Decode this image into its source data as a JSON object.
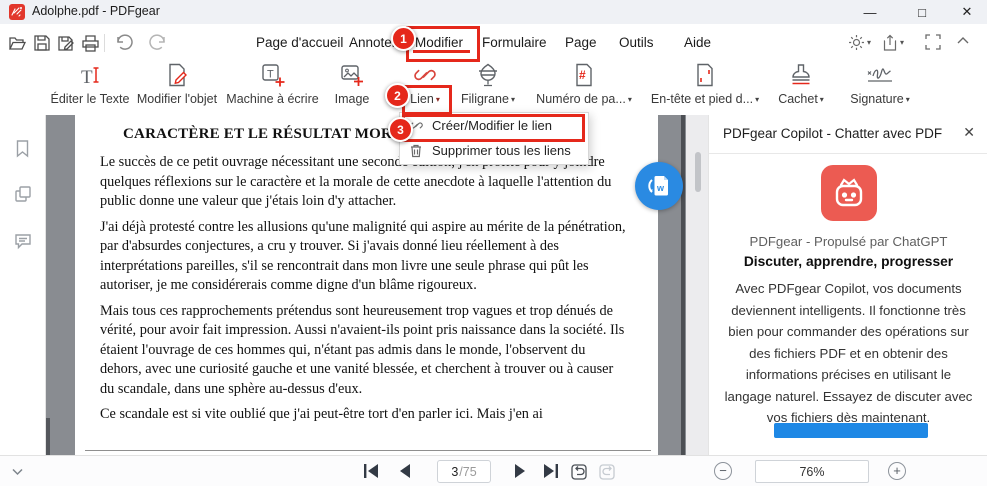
{
  "colors": {
    "annotation_red": "#e5281b",
    "pdfgear_red": "#e2372c",
    "copilot_red": "#ec5b52",
    "accent_blue": "#1e88e5",
    "doc_background": "#898c91"
  },
  "window": {
    "title": "Adolphe.pdf - PDFgear",
    "minimize": "—",
    "maximize": "□",
    "close": "✕"
  },
  "icons": {
    "caret_down": "▾",
    "close": "✕",
    "minus": "−",
    "plus": "+",
    "hash": "#",
    "letter_t": "T",
    "letter_w": "w"
  },
  "menu": {
    "items": [
      {
        "label": "Page d'accueil"
      },
      {
        "label": "Annoter"
      },
      {
        "label": "Modifier",
        "active": true
      },
      {
        "label": "Formulaire"
      },
      {
        "label": "Page"
      },
      {
        "label": "Outils"
      },
      {
        "label": "Aide"
      }
    ]
  },
  "toolbar": {
    "tools": [
      {
        "label": "Éditer le Texte"
      },
      {
        "label": "Modifier l'objet"
      },
      {
        "label": "Machine à écrire"
      },
      {
        "label": "Image"
      },
      {
        "label": "Lien",
        "caret": true,
        "highlighted": true
      },
      {
        "label": "Filigrane",
        "caret": true
      },
      {
        "label": "Numéro de pa...",
        "caret": true
      },
      {
        "label": "En-tête et pied d...",
        "caret": true
      },
      {
        "label": "Cachet",
        "caret": true
      },
      {
        "label": "Signature",
        "caret": true
      }
    ]
  },
  "steps": {
    "one": "1",
    "two": "2",
    "three": "3"
  },
  "link_menu": {
    "items": [
      {
        "label": "Créer/Modifier le lien",
        "highlighted": true
      },
      {
        "label": "Supprimer tous les liens"
      }
    ]
  },
  "document": {
    "heading": "CARACTÈRE ET LE RÉSULTAT MORAL",
    "paragraphs": [
      "Le succès de ce petit ouvrage nécessitant une seconde édition, j'en profite pour y joindre quelques réflexions sur le caractère et la morale de cette anecdote à laquelle l'attention du public donne une valeur que j'étais loin d'y attacher.",
      "J'ai déjà protesté contre les allusions qu'une malignité qui aspire au mérite de la pénétration, par d'absurdes conjectures, a cru y trouver. Si j'avais donné lieu réellement à des interprétations pareilles, s'il se rencontrait dans mon livre une seule phrase qui pût les autoriser, je me considérerais comme digne d'un blâme rigoureux.",
      "Mais tous ces rapprochements prétendus sont heureusement trop vagues et trop dénués de vérité, pour avoir fait impression. Aussi n'avaient-ils point pris naissance dans la société. Ils étaient l'ouvrage de ces hommes qui, n'étant pas admis dans le monde, l'observent du dehors, avec une curiosité gauche et une vanité blessée, et cherchent à trouver ou à causer du scandale, dans une sphère au-dessus d'eux.",
      "Ce scandale est si vite oublié que j'ai peut-être tort d'en parler ici. Mais j'en ai"
    ]
  },
  "copilot": {
    "header": "PDFgear Copilot - Chatter avec PDF",
    "brand": "PDFgear - Propulsé par ChatGPT",
    "tagline": "Discuter, apprendre, progresser",
    "body": "Avec PDFgear Copilot, vos documents deviennent intelligents.  Il fonctionne très bien pour commander des opérations sur des fichiers PDF et en obtenir des informations précises en utilisant le langage naturel.  Essayez de discuter avec vos fichiers dès maintenant."
  },
  "statusbar": {
    "page_current": "3",
    "page_total": "/75",
    "zoom_level": "76%"
  }
}
